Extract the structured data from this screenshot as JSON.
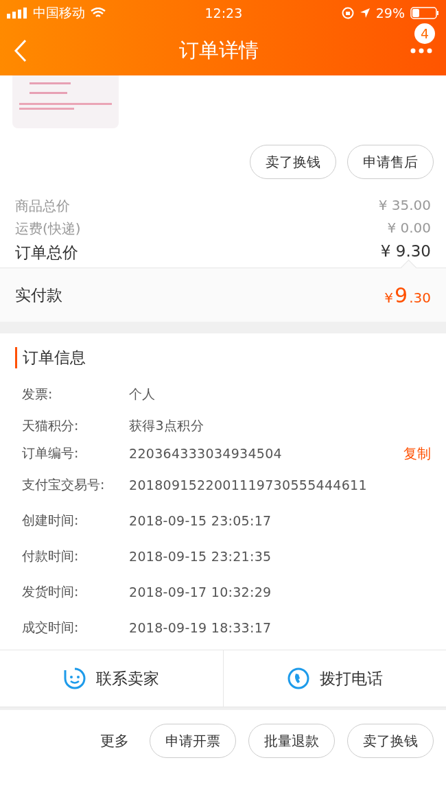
{
  "status_bar": {
    "carrier": "中国移动",
    "time": "12:23",
    "battery": "29%"
  },
  "nav": {
    "title": "订单详情",
    "badge": "4"
  },
  "product": {
    "kind": "picture"
  },
  "item_actions": [
    "卖了换钱",
    "申请售后"
  ],
  "price_rows": [
    {
      "label": "商品总价",
      "value": "¥ 35.00",
      "kind": "minor"
    },
    {
      "label": "运费(快递)",
      "value": "¥ 0.00",
      "kind": "minor"
    },
    {
      "label": "订单总价",
      "value": "¥ 9.30",
      "kind": "total"
    }
  ],
  "paid": {
    "label": "实付款",
    "currency": "¥",
    "integer": "9",
    "decimal": ".30"
  },
  "order_info": {
    "title": "订单信息",
    "rows": [
      {
        "label": "发票:",
        "value": "个人"
      },
      {
        "label": "天猫积分:",
        "value": "获得3点积分"
      },
      {
        "label": "订单编号:",
        "value": "220364333034934504",
        "action": "复制"
      },
      {
        "label": "支付宝交易号:",
        "value": "2018091522001119730555444611"
      },
      {
        "label": "创建时间:",
        "value": "2018-09-15 23:05:17"
      },
      {
        "label": "付款时间:",
        "value": "2018-09-15 23:21:35"
      },
      {
        "label": "发货时间:",
        "value": "2018-09-17 10:32:29"
      },
      {
        "label": "成交时间:",
        "value": "2018-09-19 18:33:17"
      }
    ]
  },
  "contacts": [
    {
      "label": "联系卖家",
      "kind": "chat"
    },
    {
      "label": "拨打电话",
      "kind": "phone"
    }
  ],
  "more": {
    "label": "更多",
    "buttons": [
      "申请开票",
      "批量退款",
      "卖了换钱"
    ]
  }
}
